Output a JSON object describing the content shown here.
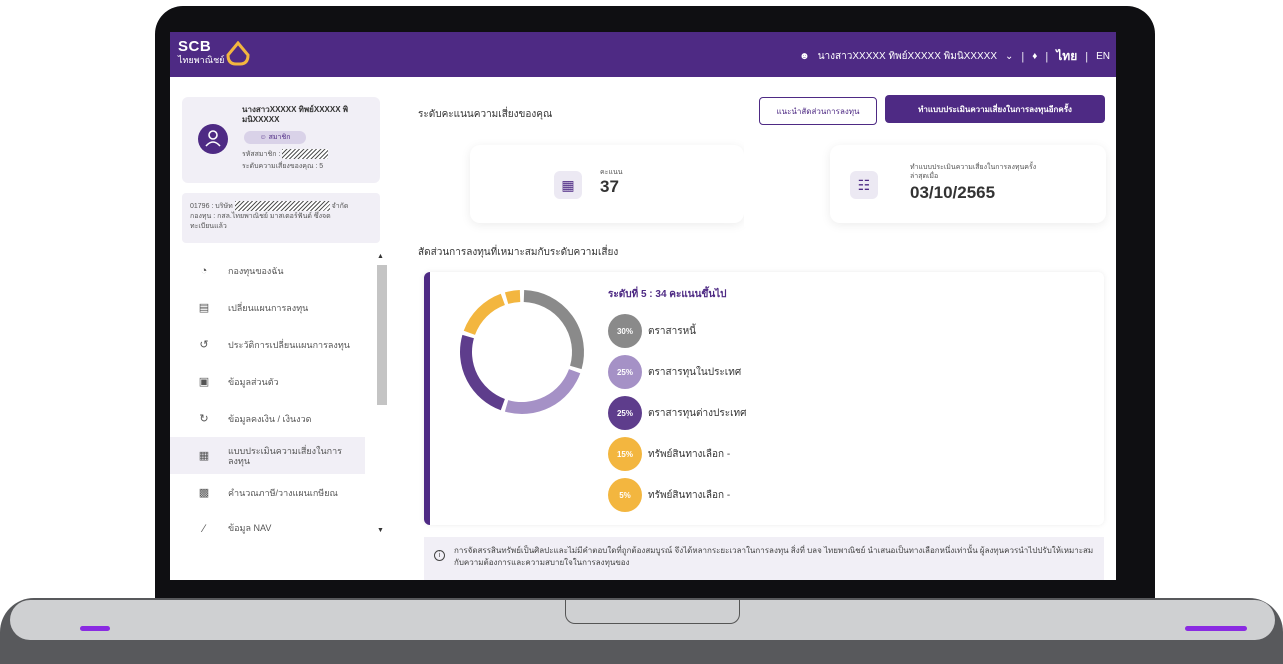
{
  "header": {
    "brand": "SCB",
    "brand_sub": "ไทยพาณิชย์",
    "user_name": "นางสาวXXXXX ทิพย์XXXXX พิมนิXXXXX",
    "lang_th": "ไทย",
    "lang_en": "EN",
    "brand_color": "#4e2a84"
  },
  "profile": {
    "name": "นางสาวXXXXX ทิพย์XXXXX พิมนิXXXXX",
    "member_label": "สมาชิก",
    "member_code_label": "รหัสสมาชิก :",
    "risk_level_text": "ระดับความเสี่ยงของคุณ : 5"
  },
  "fund_info": {
    "line1_prefix": "01796 : บริษัท",
    "line1_suffix": "จำกัด",
    "line2": "กองทุน : กสล.ไทยพาณิชย์ มาสเตอร์ฟันด์ ซึ่งจด",
    "line3": "ทะเบียนแล้ว"
  },
  "menu": [
    {
      "label": "กองทุนของฉัน",
      "icon": "pie-chart-icon"
    },
    {
      "label": "เปลี่ยนแผนการลงทุน",
      "icon": "clipboard-icon"
    },
    {
      "label": "ประวัติการเปลี่ยนแผนการลงทุน",
      "icon": "history-icon"
    },
    {
      "label": "ข้อมูลส่วนตัว",
      "icon": "id-card-icon"
    },
    {
      "label": "ข้อมูลคงเงิน / เงินงวด",
      "icon": "money-cycle-icon"
    },
    {
      "label": "แบบประเมินความเสี่ยงในการลงทุน",
      "icon": "assessment-icon",
      "active": true
    },
    {
      "label": "คำนวณภาษี/วางแผนเกษียณ",
      "icon": "calculator-icon"
    },
    {
      "label": "ข้อมูล NAV",
      "icon": "chart-line-icon"
    }
  ],
  "main": {
    "title": "ระดับคะแนนความเสี่ยงของคุณ",
    "btn_guide": "แนะนำสัดส่วนการลงทุน",
    "btn_retake": "ทำแบบประเมินความเสี่ยงในการลงทุนอีกครั้ง",
    "score_label": "คะแนน",
    "score_value": "37",
    "date_label": "ทำแบบประเมินความเสี่ยงในการลงทุนครั้งล่าสุดเมื่อ",
    "date_value": "03/10/2565",
    "alloc_title": "สัดส่วนการลงทุนที่เหมาะสมกับระดับความเสี่ยง",
    "level_text": "ระดับที่ 5 : 34 คะแนนขึ้นไป",
    "notice": "การจัดสรรสินทรัพย์เป็นศิลปะและไม่มีคำตอบใดที่ถูกต้องสมบูรณ์ จึงได้หลากระยะเวลาในการลงทุน สิ่งที่ บลจ ไทยพาณิชย์ นำเสนอเป็นทางเลือกหนึ่งเท่านั้น ผู้ลงทุนควรนำไปปรับให้เหมาะสมกับความต้องการและความสบายใจในการลงทุนของ"
  },
  "allocation": [
    {
      "label": "ตราสารหนี้",
      "pct": "30%",
      "value": 30,
      "color": "#8a8a8a"
    },
    {
      "label": "ตราสารทุนในประเทศ",
      "pct": "25%",
      "value": 25,
      "color": "#a591c6"
    },
    {
      "label": "ตราสารทุนต่างประเทศ",
      "pct": "25%",
      "value": 25,
      "color": "#5e3d8c"
    },
    {
      "label": "ทรัพย์สินทางเลือก -",
      "pct": "15%",
      "value": 15,
      "color": "#f3b63f"
    },
    {
      "label": "ทรัพย์สินทางเลือก -",
      "pct": "5%",
      "value": 5,
      "color": "#f3b63f"
    }
  ]
}
